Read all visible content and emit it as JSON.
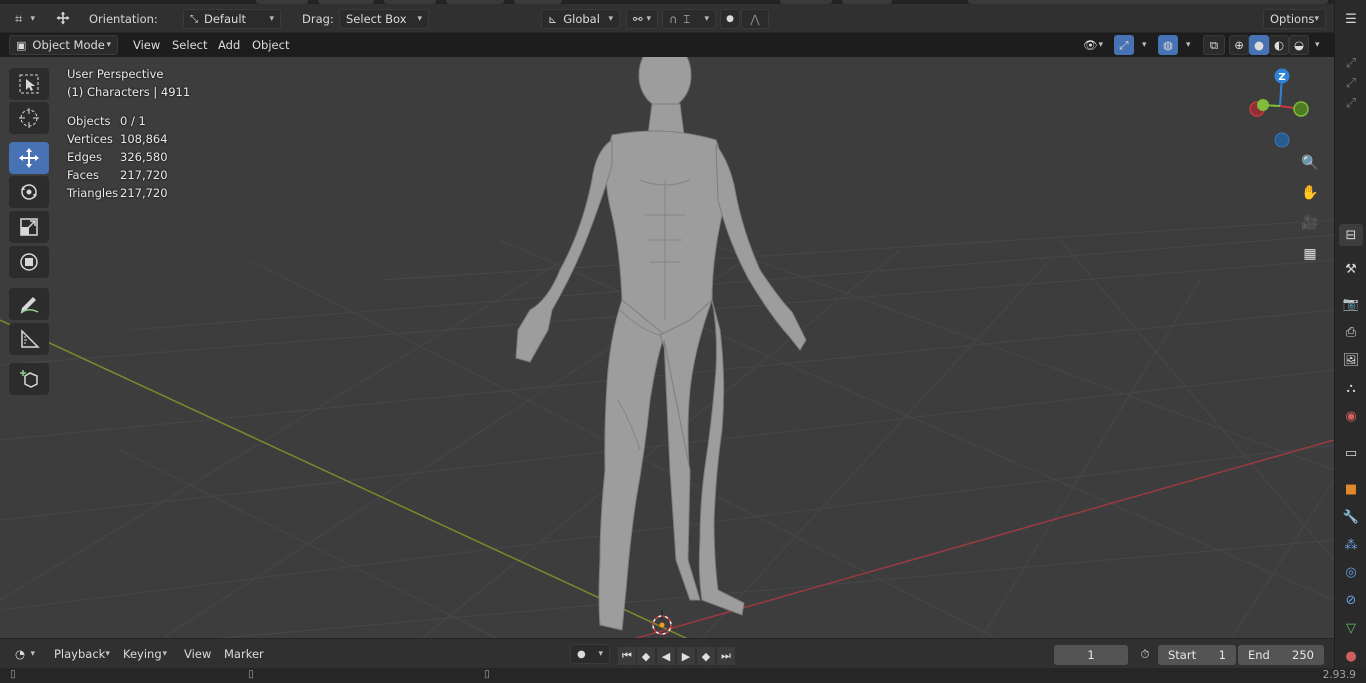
{
  "header": {
    "orientation_label": "Orientation:",
    "orientation_value": "Default",
    "drag_label": "Drag:",
    "drag_value": "Select Box",
    "transform_space": "Global",
    "options_label": "Options"
  },
  "menu": {
    "mode": "Object Mode",
    "view": "View",
    "select": "Select",
    "add": "Add",
    "object": "Object"
  },
  "viewport": {
    "perspective": "User Perspective",
    "collection": "(1) Characters | 4911",
    "stats": [
      {
        "key": "Objects",
        "value": "0 / 1"
      },
      {
        "key": "Vertices",
        "value": "108,864"
      },
      {
        "key": "Edges",
        "value": "326,580"
      },
      {
        "key": "Faces",
        "value": "217,720"
      },
      {
        "key": "Triangles",
        "value": "217,720"
      }
    ],
    "gizmo_z": "Z"
  },
  "timeline": {
    "playback": "Playback",
    "keying": "Keying",
    "view": "View",
    "marker": "Marker",
    "current_frame": "1",
    "start_label": "Start",
    "start_value": "1",
    "end_label": "End",
    "end_value": "250"
  },
  "status": {
    "version": "2.93.9"
  },
  "colors": {
    "active_tool": "#4772b3",
    "x_axis": "#c8383f",
    "y_axis": "#7fbd3a",
    "z_axis": "#2f83d6",
    "viewport_bg": "#3d3d3d"
  }
}
